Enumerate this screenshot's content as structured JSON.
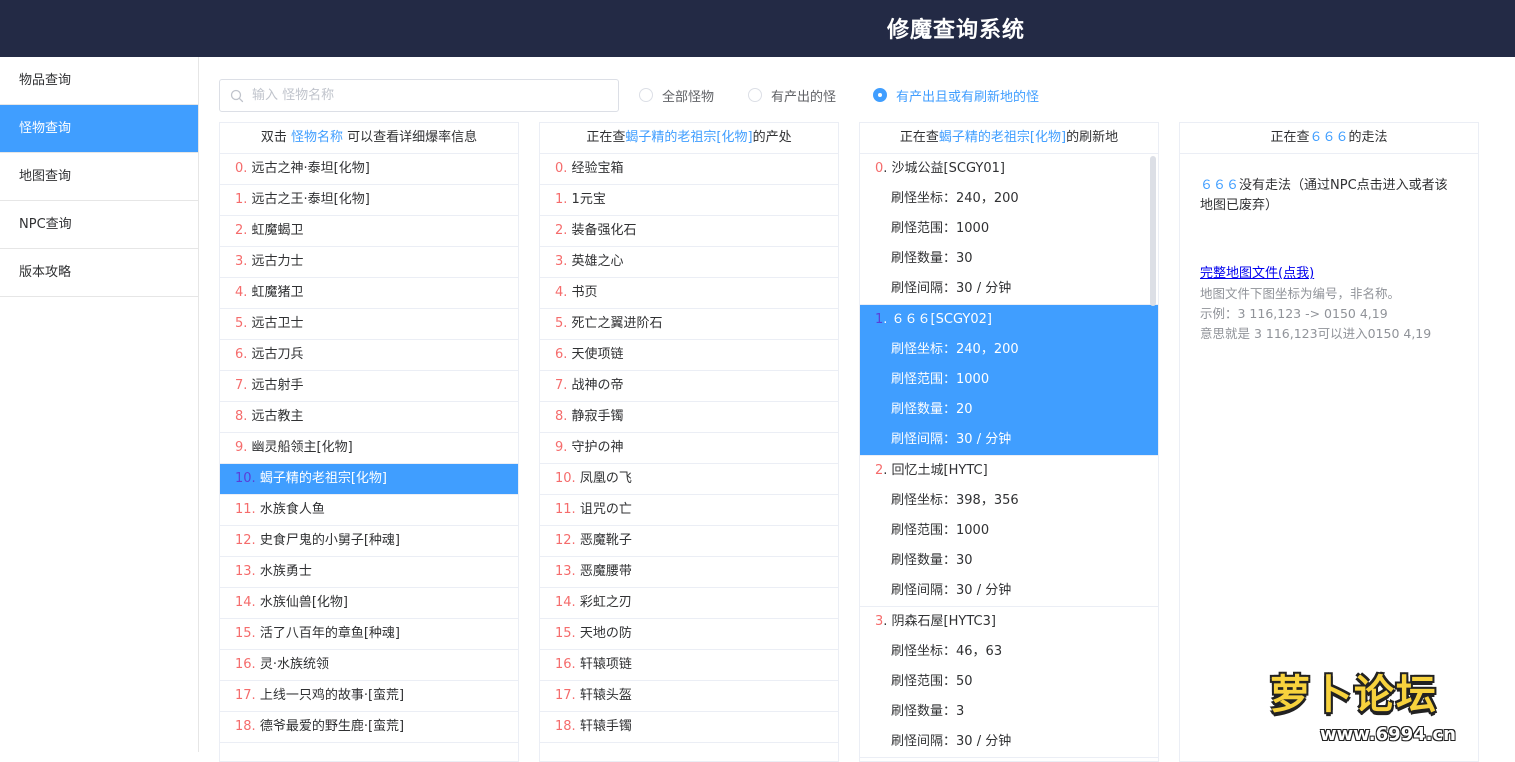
{
  "header": {
    "title": "修魔查询系统"
  },
  "sidebar": {
    "items": [
      {
        "label": "物品查询",
        "active": false
      },
      {
        "label": "怪物查询",
        "active": true
      },
      {
        "label": "地图查询",
        "active": false
      },
      {
        "label": "NPC查询",
        "active": false
      },
      {
        "label": "版本攻略",
        "active": false
      }
    ]
  },
  "search": {
    "placeholder": "输入 怪物名称",
    "value": ""
  },
  "filters": {
    "options": [
      "全部怪物",
      "有产出的怪",
      "有产出且或有刷新地的怪"
    ],
    "selected": 2
  },
  "colors": {
    "accent": "#409eff",
    "index": "#f56c6c",
    "header_bg": "#232a45"
  },
  "monster_panel": {
    "head_prefix": "双击 ",
    "head_highlight": "怪物名称",
    "head_suffix": " 可以查看详细爆率信息",
    "selected_index": 10,
    "items": [
      "远古之神·泰坦[化物]",
      "远古之王·泰坦[化物]",
      "虹魔蝎卫",
      "远古力士",
      "虹魔猪卫",
      "远古卫士",
      "远古刀兵",
      "远古射手",
      "远古教主",
      "幽灵船领主[化物]",
      "蝎子精的老祖宗[化物]",
      "水族食人鱼",
      "史食尸鬼的小舅子[种魂]",
      "水族勇士",
      "水族仙兽[化物]",
      "活了八百年的章鱼[种魂]",
      "灵·水族统领",
      "上线一只鸡的故事·[蛮荒]",
      "德爷最爱的野生鹿·[蛮荒]"
    ]
  },
  "drops_panel": {
    "head_prefix": "正在查",
    "head_highlight": "蝎子精的老祖宗[化物]",
    "head_suffix": "的产处",
    "items": [
      "经验宝箱",
      "1元宝",
      "装备强化石",
      "英雄之心",
      "书页",
      "死亡之翼进阶石",
      "天使项链",
      "战神の帝",
      "静寂手镯",
      "守护の神",
      "凤凰の飞",
      "诅咒の亡",
      "恶魔靴子",
      "恶魔腰带",
      "彩虹之刃",
      "天地の防",
      "轩辕项链",
      "轩辕头盔",
      "轩辕手镯"
    ]
  },
  "refresh_panel": {
    "head_prefix": "正在查",
    "head_highlight": "蝎子精的老祖宗[化物]",
    "head_suffix": "的刷新地",
    "selected_index": 1,
    "label_coord": "刷怪坐标：",
    "label_range": "刷怪范围：",
    "label_count": "刷怪数量：",
    "label_interval": "刷怪间隔：",
    "groups": [
      {
        "idx": "0",
        "name": "沙城公益[SCGY01]",
        "coord": "240，200",
        "range": "1000",
        "count": "30",
        "interval": "30 / 分钟"
      },
      {
        "idx": "1",
        "name": "６６６[SCGY02]",
        "coord": "240，200",
        "range": "1000",
        "count": "20",
        "interval": "30 / 分钟"
      },
      {
        "idx": "2",
        "name": "回忆土城[HYTC]",
        "coord": "398，356",
        "range": "1000",
        "count": "30",
        "interval": "30 / 分钟"
      },
      {
        "idx": "3",
        "name": "阴森石屋[HYTC3]",
        "coord": "46，63",
        "range": "50",
        "count": "3",
        "interval": "30 / 分钟"
      }
    ]
  },
  "route_panel": {
    "head_prefix": "正在查",
    "head_highlight": "６６６",
    "head_suffix": "的走法",
    "msg_highlight": "６６６",
    "msg_text": "没有走法（通过NPC点击进入或者该地图已废弃）",
    "link": "完整地图文件(点我)",
    "note1": "地图文件下图坐标为编号，非名称。",
    "note2": "示例：3 116,123 -> 0150 4,19",
    "note3": "意思就是 3 116,123可以进入0150 4,19"
  },
  "watermark": {
    "text": "萝卜论坛",
    "url": "www.6994.cn"
  }
}
